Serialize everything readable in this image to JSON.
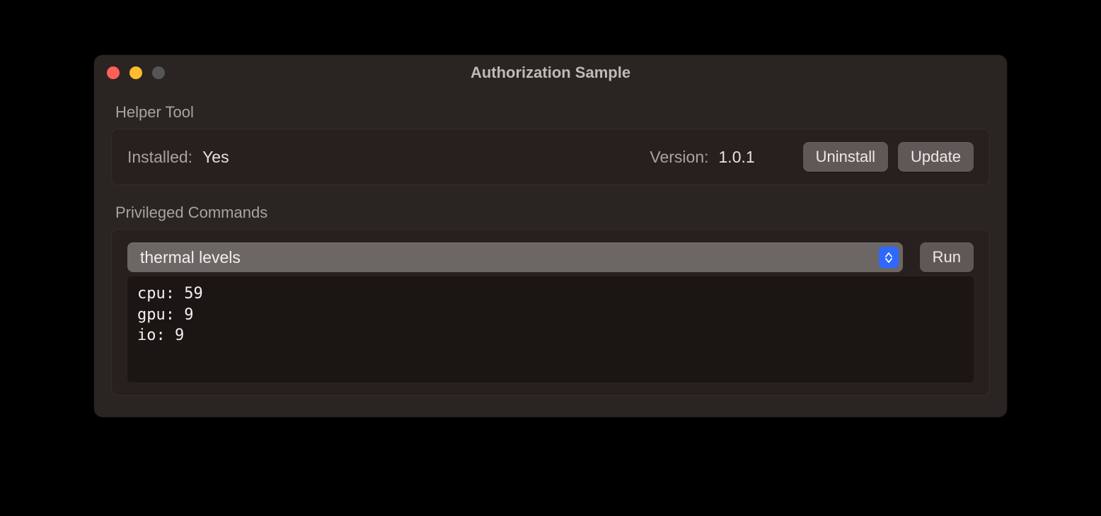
{
  "window": {
    "title": "Authorization Sample"
  },
  "helper": {
    "section_label": "Helper Tool",
    "installed_label": "Installed:",
    "installed_value": "Yes",
    "version_label": "Version:",
    "version_value": "1.0.1",
    "uninstall_label": "Uninstall",
    "update_label": "Update"
  },
  "commands": {
    "section_label": "Privileged Commands",
    "selected": "thermal levels",
    "run_label": "Run",
    "output": "cpu: 59\ngpu: 9\nio: 9"
  }
}
